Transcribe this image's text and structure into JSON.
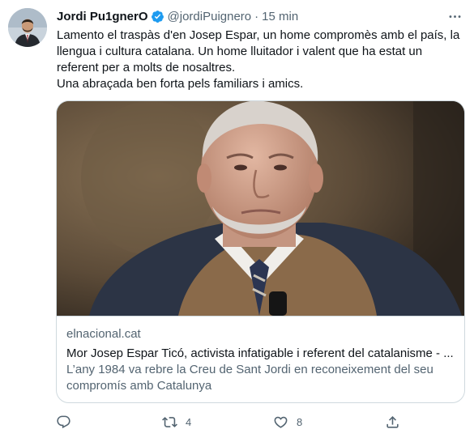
{
  "colors": {
    "text_primary": "#0f1419",
    "text_secondary": "#536471",
    "verified_blue": "#1d9bf0",
    "border": "#cfd9de"
  },
  "tweet": {
    "author_name": "Jordi Pu1gnerO",
    "author_handle": "@jordiPuignero",
    "separator": "·",
    "timestamp": "15 min",
    "verified": true,
    "text_lines": [
      "Lamento el traspàs d'en Josep Espar, un home compromès amb el país, la llengua i cultura catalana. Un home lluitador i valent que ha estat un referent per a molts de nosaltres.",
      "Una abraçada ben forta pels familiars i amics."
    ],
    "card": {
      "domain": "elnacional.cat",
      "title": "Mor Josep Espar Ticó, activista infatigable i referent del catalanisme - ...",
      "description": "L’any 1984 va rebre la Creu de Sant Jordi en reconeixement del seu compromís amb Catalunya"
    },
    "actions": {
      "reply_count": "",
      "retweet_count": "4",
      "like_count": "8"
    },
    "icons": [
      "more-icon",
      "verified-badge-icon",
      "reply-icon",
      "retweet-icon",
      "like-icon",
      "share-icon"
    ]
  }
}
